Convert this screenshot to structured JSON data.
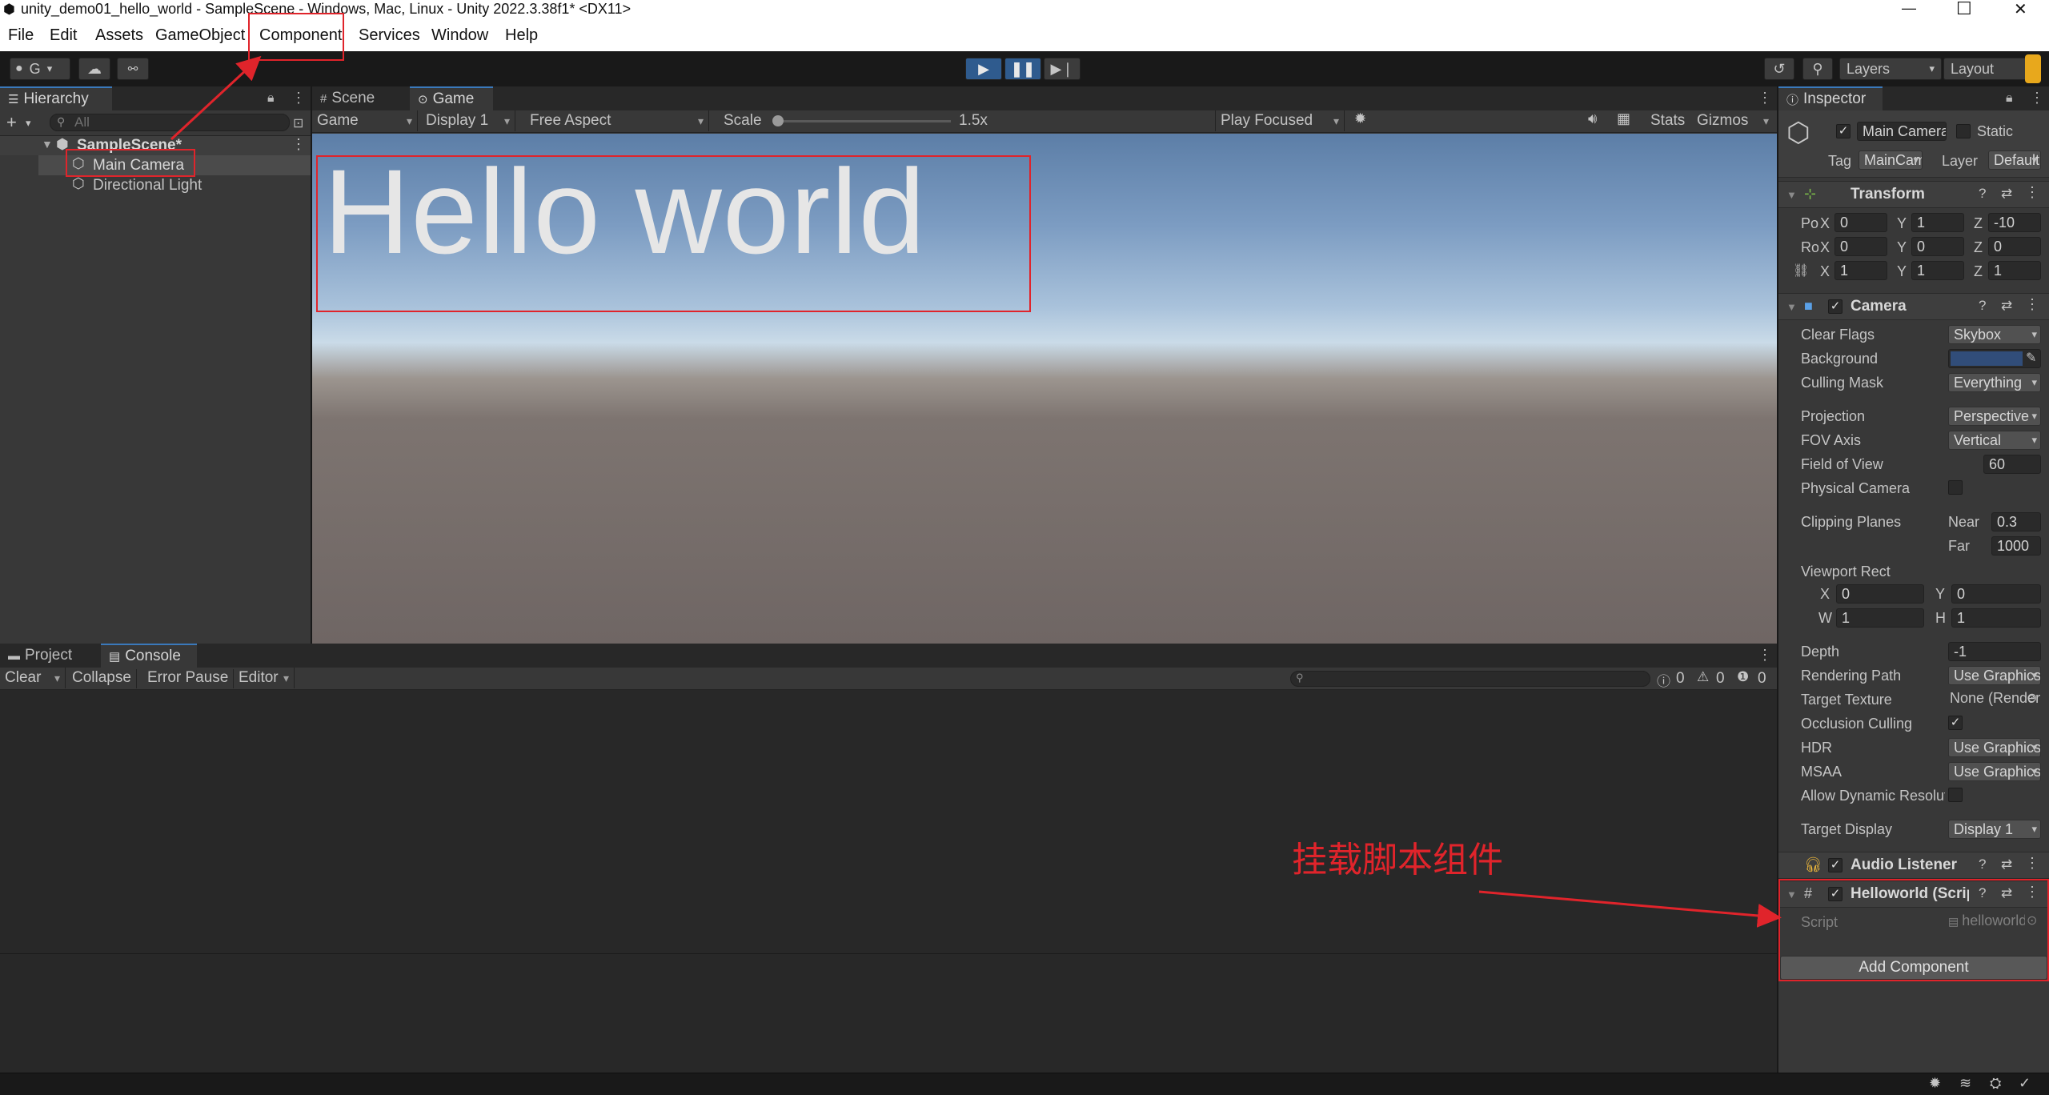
{
  "window": {
    "title": "unity_demo01_hello_world - SampleScene - Windows, Mac, Linux - Unity 2022.3.38f1* <DX11>",
    "minimize": "—",
    "maximize": "☐",
    "close": "✕"
  },
  "menu": {
    "items": [
      "File",
      "Edit",
      "Assets",
      "GameObject",
      "Component",
      "Services",
      "Window",
      "Help"
    ]
  },
  "toolbar": {
    "account": "G",
    "layers": "Layers",
    "layout": "Layout"
  },
  "hierarchy": {
    "tab": "Hierarchy",
    "search_placeholder": "All",
    "scene": "SampleScene*",
    "items": [
      "Main Camera",
      "Directional Light"
    ]
  },
  "view": {
    "tabs": [
      "Scene",
      "Game"
    ],
    "game_dd": "Game",
    "display_dd": "Display 1",
    "aspect_dd": "Free Aspect",
    "scale_label": "Scale",
    "scale_value": "1.5x",
    "play_focused": "Play Focused",
    "stats": "Stats",
    "gizmos": "Gizmos",
    "hello_text": "Hello world"
  },
  "bottom": {
    "tabs": [
      "Project",
      "Console"
    ],
    "clear": "Clear",
    "collapse": "Collapse",
    "error_pause": "Error Pause",
    "editor": "Editor",
    "counts": [
      "0",
      "0",
      "0"
    ]
  },
  "inspector": {
    "tab": "Inspector",
    "object_name": "Main Camera",
    "static_label": "Static",
    "tag_label": "Tag",
    "tag_value": "MainCamera",
    "layer_label": "Layer",
    "layer_value": "Default",
    "transform": {
      "title": "Transform",
      "pos_label": "Position",
      "rot_label": "Rotation",
      "position": [
        "0",
        "1",
        "-10"
      ],
      "rotation": [
        "0",
        "0",
        "0"
      ],
      "scale": [
        "1",
        "1",
        "1"
      ]
    },
    "camera": {
      "title": "Camera",
      "clear_flags": "Clear Flags",
      "clear_flags_value": "Skybox",
      "background": "Background",
      "background_color": "#314d79",
      "culling_mask": "Culling Mask",
      "culling_mask_value": "Everything",
      "projection": "Projection",
      "projection_value": "Perspective",
      "fov_axis": "FOV Axis",
      "fov_axis_value": "Vertical",
      "field_of_view": "Field of View",
      "field_of_view_value": "60",
      "physical_camera": "Physical Camera",
      "clipping_planes": "Clipping Planes",
      "near_label": "Near",
      "near_value": "0.3",
      "far_label": "Far",
      "far_value": "1000",
      "viewport_rect": "Viewport Rect",
      "vp_x": "0",
      "vp_y": "0",
      "vp_w": "1",
      "vp_h": "1",
      "depth": "Depth",
      "depth_value": "-1",
      "rendering_path": "Rendering Path",
      "rendering_path_value": "Use Graphics Settings",
      "target_texture": "Target Texture",
      "target_texture_value": "None (Render Texture)",
      "occlusion_culling": "Occlusion Culling",
      "hdr": "HDR",
      "hdr_value": "Use Graphics Settings",
      "msaa": "MSAA",
      "msaa_value": "Use Graphics Settings",
      "allow_dynamic": "Allow Dynamic Resolution",
      "target_display": "Target Display",
      "target_display_value": "Display 1"
    },
    "audio_listener": "Audio Listener",
    "helloworld": {
      "title": "Helloworld (Script)",
      "script_label": "Script",
      "script_value": "helloworld"
    },
    "add_component": "Add Component"
  },
  "annotation": {
    "text": "挂载脚本组件"
  }
}
